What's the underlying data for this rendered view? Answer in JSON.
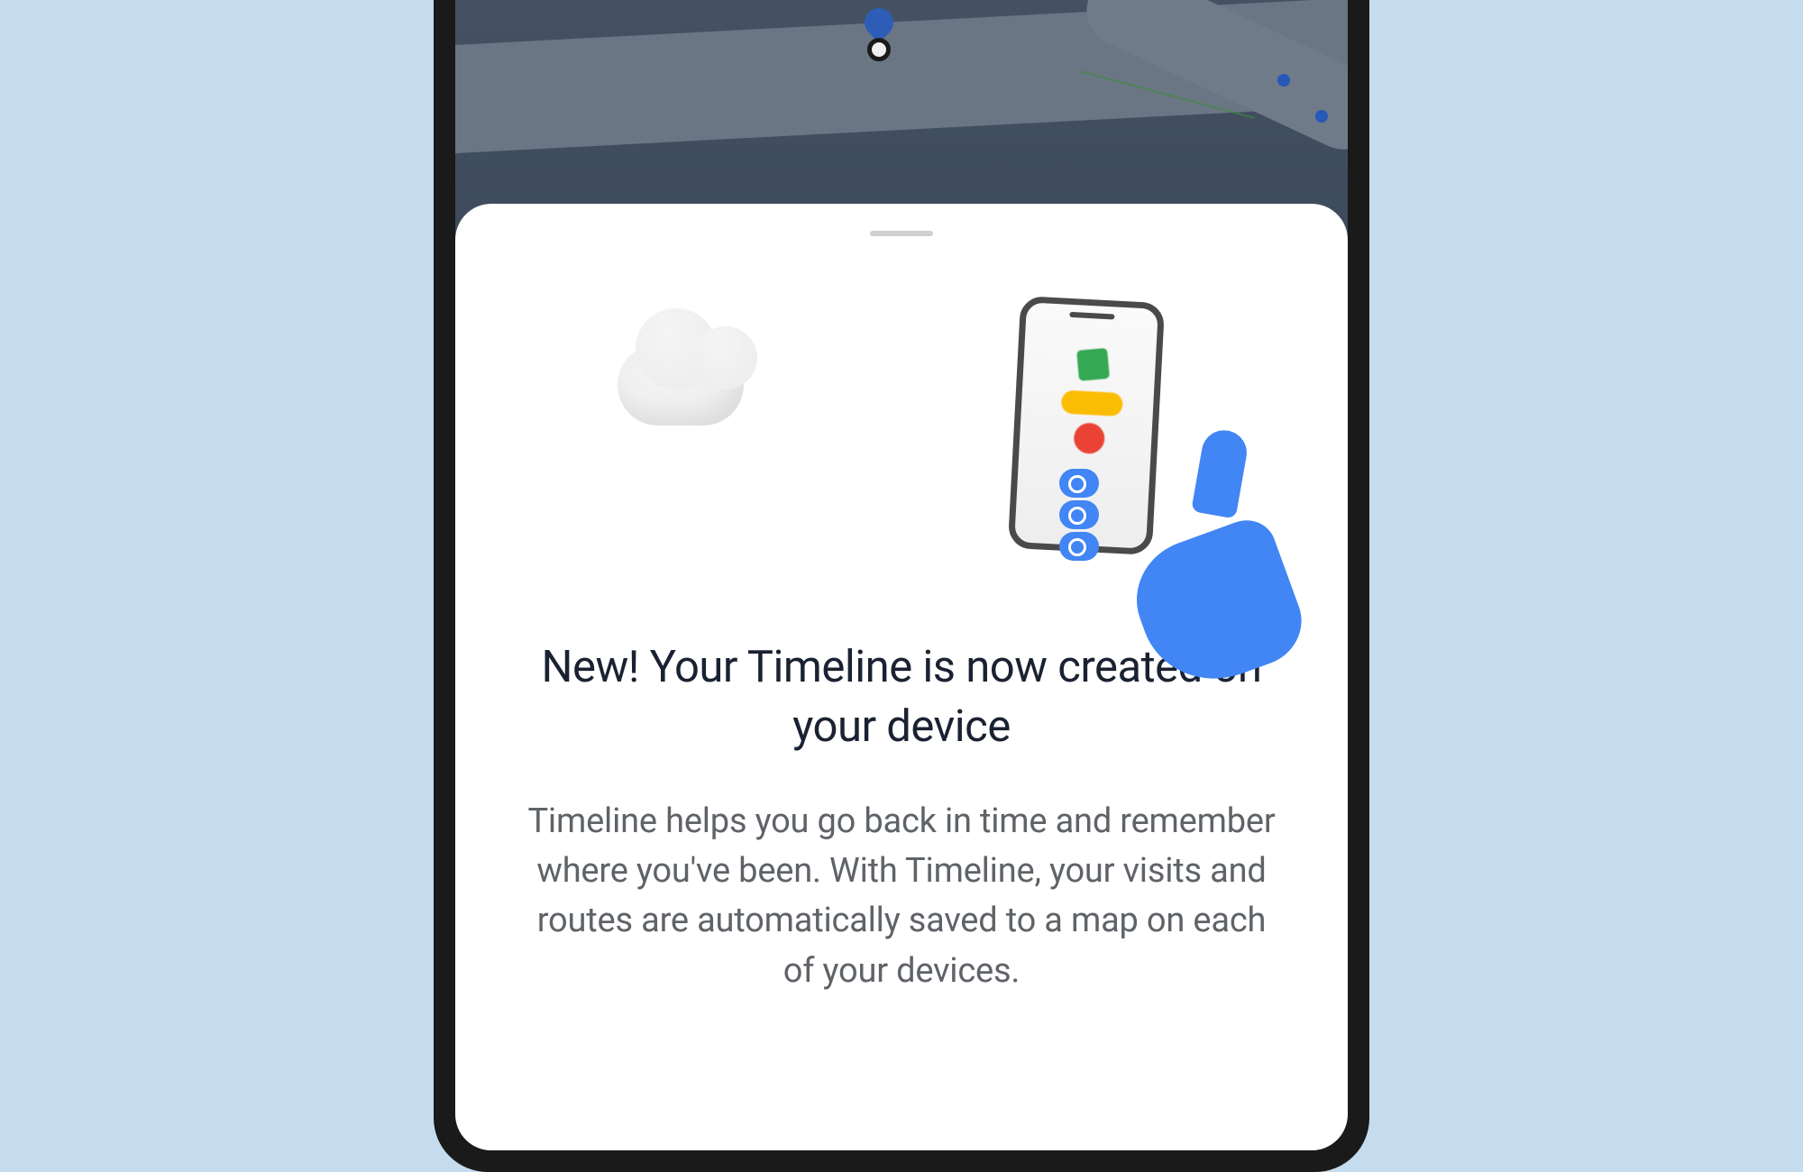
{
  "sheet": {
    "title": "New! Your Timeline is now created on your device",
    "body": "Timeline helps you go back in time and remember where you've been.  With Timeline, your visits and routes are automatically saved to a map on each of your devices."
  },
  "illustration": {
    "cloud_icon": "cloud-icon",
    "phone_icon": "phone-in-hand-icon",
    "shapes": [
      "green-square",
      "yellow-pill",
      "red-circle"
    ]
  },
  "colors": {
    "background": "#c5dcee",
    "google_blue": "#4285f4",
    "google_green": "#34a853",
    "google_yellow": "#fbbc04",
    "google_red": "#ea4335"
  }
}
